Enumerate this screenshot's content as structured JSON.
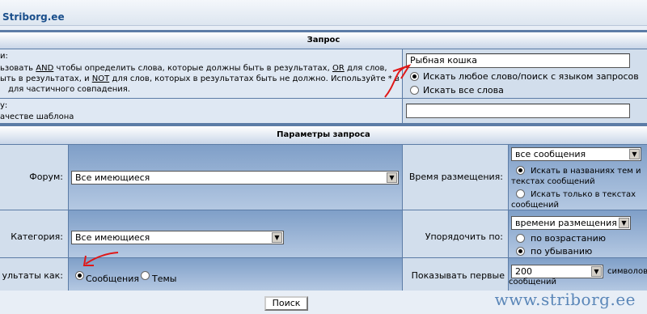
{
  "site": {
    "logo": "Striborg.ee"
  },
  "search": {
    "header": "Запрос",
    "keywords_label": "и:",
    "help_p1": "ьзовать",
    "help_and": "AND",
    "help_p2": "чтобы определить слова, которые должны быть в результатах,",
    "help_or": "OR",
    "help_p3": "для слов,",
    "help_p4": "ыть в результатах, и",
    "help_not": "NOT",
    "help_p5": "для слов, которых в результатах быть не должно. Используйте * в",
    "help_p6": "для частичного совпадения.",
    "query_value": "Рыбная кошка",
    "opt_any": "Искать любое слово/поиск с языком запросов",
    "opt_all": "Искать все слова",
    "author_label": "у:",
    "author_help": "ачестве шаблона",
    "author_value": ""
  },
  "params": {
    "header": "Параметры запроса",
    "forum_label": "Форум:",
    "forum_value": "Все имеющиеся",
    "time_label": "Время размещения:",
    "time_value": "все сообщения",
    "search_titles": "Искать в названиях тем и текстах сообщений",
    "search_text": "Искать только в текстах сообщений",
    "category_label": "Категория:",
    "category_value": "Все имеющиеся",
    "sort_label": "Упорядочить по:",
    "sort_value": "времени размещения",
    "sort_asc": "по возрастанию",
    "sort_desc": "по убыванию",
    "results_label": "ультаты как:",
    "results_posts": "Сообщения",
    "results_topics": "Темы",
    "show_first_label": "Показывать первые",
    "show_first_value": "200",
    "chars_of_posts": "символов сообщений"
  },
  "submit": {
    "label": "Поиск"
  },
  "watermark": "www.striborg.ee"
}
